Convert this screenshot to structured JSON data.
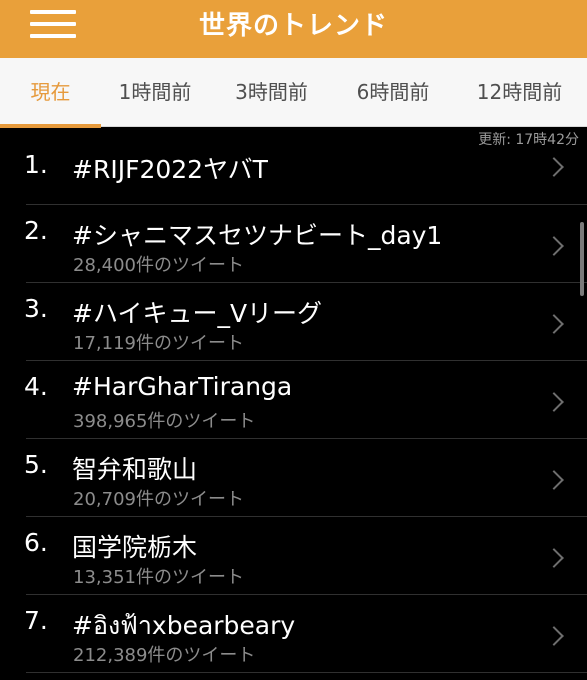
{
  "header": {
    "title": "世界のトレンド",
    "menu_icon": "hamburger-menu-icon",
    "accent_color": "#e9a03a"
  },
  "tabs": [
    {
      "label": "現在",
      "active": true
    },
    {
      "label": "1時間前",
      "active": false
    },
    {
      "label": "3時間前",
      "active": false
    },
    {
      "label": "6時間前",
      "active": false
    },
    {
      "label": "12時間前",
      "active": false
    }
  ],
  "updated": "更新: 17時42分",
  "trends": [
    {
      "rank": "1.",
      "name": "#RIJF2022ヤバT",
      "count": ""
    },
    {
      "rank": "2.",
      "name": "#シャニマスセツナビート_day1",
      "count": "28,400件のツイート"
    },
    {
      "rank": "3.",
      "name": "#ハイキュー_Vリーグ",
      "count": "17,119件のツイート"
    },
    {
      "rank": "4.",
      "name": "#HarGharTiranga",
      "count": "398,965件のツイート"
    },
    {
      "rank": "5.",
      "name": "智弁和歌山",
      "count": "20,709件のツイート"
    },
    {
      "rank": "6.",
      "name": "国学院栃木",
      "count": "13,351件のツイート"
    },
    {
      "rank": "7.",
      "name": "#อิงฟ้าxbearbeary",
      "count": "212,389件のツイート"
    }
  ]
}
